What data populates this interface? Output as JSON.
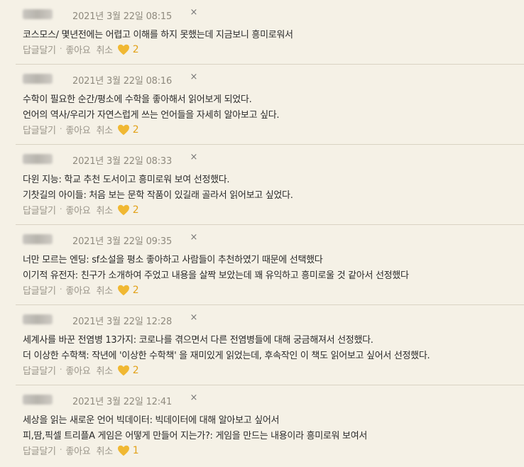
{
  "labels": {
    "reply": "답글달기",
    "like": "좋아요",
    "cancel": "취소",
    "delete": "×"
  },
  "comments": [
    {
      "date": "2021년 3월 22일 08:15",
      "lines": [
        "코스모스/ 몇년전에는 어렵고 이해를 하지 못했는데 지금보니 흥미로워서"
      ],
      "likes": "2"
    },
    {
      "date": "2021년 3월 22일 08:16",
      "lines": [
        "수학이 필요한 순간/평소에 수학을 좋아해서 읽어보게 되었다.",
        "언어의 역사/우리가 자연스럽게 쓰는 언어들을 자세히 알아보고 싶다."
      ],
      "likes": "2"
    },
    {
      "date": "2021년 3월 22일 08:33",
      "lines": [
        "다윈 지능: 학교 추천 도서이고 흥미로워 보여 선정했다.",
        "기찻길의 아이들: 처음 보는 문학 작품이 있길래 골라서 읽어보고 싶었다."
      ],
      "likes": "2"
    },
    {
      "date": "2021년 3월 22일 09:35",
      "lines": [
        "너만 모르는 엔딩: sf소설을 평소 좋아하고 사람들이 추천하였기 때문에 선택했다",
        "이기적 유전자: 친구가 소개하여 주었고 내용을 살짝 보았는데 꽤 유익하고 흥미로울 것 같아서 선정했다"
      ],
      "likes": "2"
    },
    {
      "date": "2021년 3월 22일 12:28",
      "lines": [
        "세계사를 바꾼 전염병 13가지: 코로나를 겪으면서 다른 전염병들에 대해 궁금해져서 선정했다.",
        "더 이상한 수학책: 작년에 '이상한 수학책' 을 재미있게 읽었는데, 후속작인 이 책도 읽어보고 싶어서 선정했다."
      ],
      "likes": "2"
    },
    {
      "date": "2021년 3월 22일 12:41",
      "lines": [
        "세상을 읽는 새로운 언어 빅데이터: 빅데이터에 대해 알아보고 싶어서",
        "피,땀,픽셀 트리플A 게임은 어떻게 만들어 지는가?: 게임을 만드는 내용이라 흥미로워 보여서"
      ],
      "likes": "1"
    }
  ],
  "colors": {
    "heart": "#f0b833",
    "background": "#f5f1e6",
    "divider": "#d9d3c3"
  }
}
